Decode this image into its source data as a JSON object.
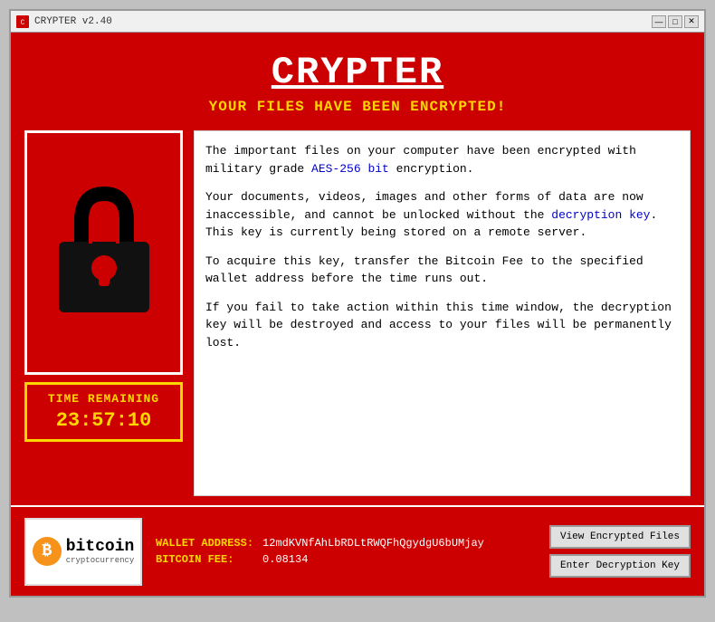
{
  "window": {
    "title": "CRYPTER v2.40",
    "icon": "crypter-icon",
    "controls": {
      "minimize": "—",
      "maximize": "□",
      "close": "✕"
    }
  },
  "header": {
    "title": "CRYPTER",
    "subtitle": "YOUR FILES HAVE BEEN ENCRYPTED!"
  },
  "lock_image": {
    "alt": "padlock-icon"
  },
  "timer": {
    "label": "TIME REMAINING",
    "value": "23:57:10"
  },
  "message": {
    "paragraph1": "The important files on your computer have been encrypted with military grade AES-256 bit encryption.",
    "paragraph2": "Your documents, videos, images and other forms of data are now inaccessible, and cannot be unlocked without the decryption key. This key is currently being stored on a remote server.",
    "paragraph3": "To acquire this key, transfer the Bitcoin Fee to the specified wallet address before the time runs out.",
    "paragraph4": "If you fail to take action within this time window, the decryption key will be destroyed and access to your files will be permanently lost."
  },
  "bitcoin": {
    "logo_text": "bitcoin",
    "symbol": "₿",
    "subtext": "cryptocurrency"
  },
  "wallet": {
    "address_label": "WALLET ADDRESS:",
    "address_value": "12mdKVNfAhLbRDLtRWQFhQgydgU6bUMjay",
    "fee_label": "BITCOIN FEE:",
    "fee_value": "0.08134"
  },
  "buttons": {
    "view_files": "View Encrypted Files",
    "enter_key": "Enter Decryption Key"
  }
}
